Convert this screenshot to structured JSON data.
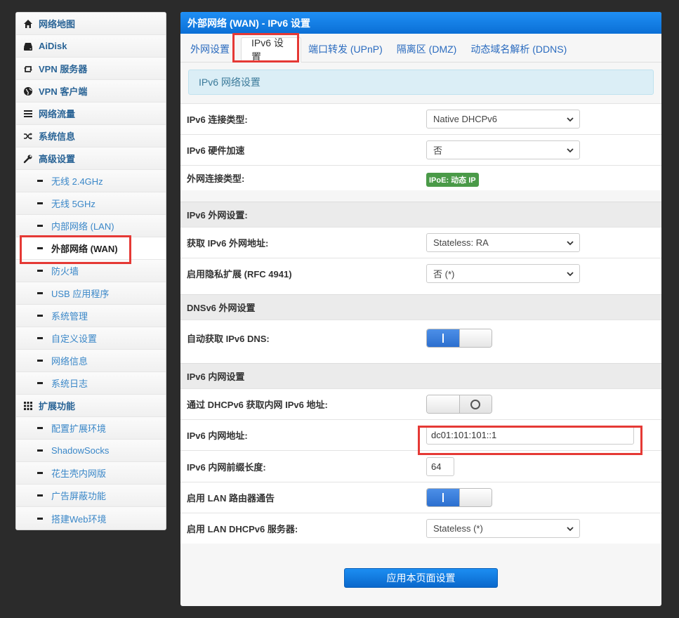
{
  "sidebar": {
    "items": [
      {
        "label": "网络地图",
        "icon": "home-icon",
        "type": "top"
      },
      {
        "label": "AiDisk",
        "icon": "hdd-icon",
        "type": "top"
      },
      {
        "label": "VPN 服务器",
        "icon": "retweet-icon",
        "type": "top"
      },
      {
        "label": "VPN 客户端",
        "icon": "globe-icon",
        "type": "top"
      },
      {
        "label": "网络流量",
        "icon": "list-icon",
        "type": "top"
      },
      {
        "label": "系统信息",
        "icon": "shuffle-icon",
        "type": "top"
      },
      {
        "label": "高级设置",
        "icon": "wrench-icon",
        "type": "top"
      },
      {
        "label": "无线 2.4GHz",
        "type": "sub"
      },
      {
        "label": "无线 5GHz",
        "type": "sub"
      },
      {
        "label": "内部网络 (LAN)",
        "type": "sub"
      },
      {
        "label": "外部网络 (WAN)",
        "type": "sub",
        "active": true
      },
      {
        "label": "防火墙",
        "type": "sub"
      },
      {
        "label": "USB 应用程序",
        "type": "sub"
      },
      {
        "label": "系统管理",
        "type": "sub"
      },
      {
        "label": "自定义设置",
        "type": "sub"
      },
      {
        "label": "网络信息",
        "type": "sub"
      },
      {
        "label": "系统日志",
        "type": "sub"
      },
      {
        "label": "扩展功能",
        "icon": "grid-icon",
        "type": "top"
      },
      {
        "label": "配置扩展环境",
        "type": "sub"
      },
      {
        "label": "ShadowSocks",
        "type": "sub"
      },
      {
        "label": "花生壳内网版",
        "type": "sub"
      },
      {
        "label": "广告屏蔽功能",
        "type": "sub"
      },
      {
        "label": "搭建Web环境",
        "type": "sub"
      }
    ]
  },
  "panel": {
    "title": "外部网络 (WAN) - IPv6 设置",
    "tabs": [
      "外网设置",
      "IPv6 设置",
      "端口转发 (UPnP)",
      "隔离区 (DMZ)",
      "动态域名解析 (DDNS)"
    ],
    "active_tab": 1,
    "info": "IPv6 网络设置"
  },
  "fields": {
    "conn_type": {
      "label": "IPv6 连接类型:",
      "value": "Native DHCPv6"
    },
    "hw_accel": {
      "label": "IPv6 硬件加速",
      "value": "否"
    },
    "wan_type": {
      "label": "外网连接类型:",
      "badge": "IPoE: 动态 IP"
    },
    "sec_wan": "IPv6 外网设置:",
    "get_addr": {
      "label": "获取 IPv6 外网地址:",
      "value": "Stateless: RA"
    },
    "privacy": {
      "label": "启用隐私扩展 (RFC 4941)",
      "value": "否 (*)"
    },
    "sec_dns": "DNSv6 外网设置",
    "auto_dns": {
      "label": "自动获取 IPv6 DNS:",
      "on": true
    },
    "sec_lan": "IPv6 内网设置",
    "dhcp_lan": {
      "label": "通过 DHCPv6 获取内网 IPv6 地址:",
      "on": false
    },
    "lan_addr": {
      "label": "IPv6 内网地址:",
      "value": "dc01:101:101::1"
    },
    "prefix_len": {
      "label": "IPv6 内网前缀长度:",
      "value": "64"
    },
    "ra": {
      "label": "启用 LAN 路由器通告",
      "on": true
    },
    "dhcp_server": {
      "label": "启用 LAN DHCPv6 服务器:",
      "value": "Stateless (*)"
    }
  },
  "apply_label": "应用本页面设置",
  "colors": {
    "accent": "#1a84ea",
    "highlight": "#e53935",
    "badge": "#4a9a48"
  }
}
